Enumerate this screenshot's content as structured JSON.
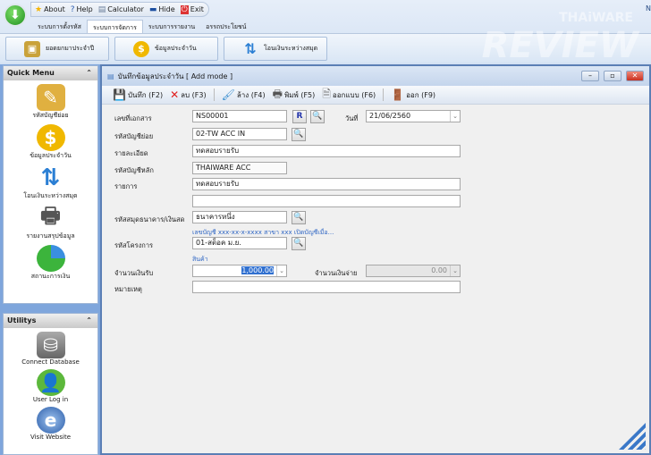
{
  "quick_access": {
    "about": "About",
    "help": "Help",
    "calculator": "Calculator",
    "hide": "Hide",
    "exit": "Exit"
  },
  "tabs": [
    "ระบบการตั้งรหัส",
    "ระบบการจัดการ",
    "ระบบการรายงาน",
    "อรรถประโยชน์"
  ],
  "active_tab": 1,
  "ribbon_buttons": [
    "ยอดยกมาประจำปี",
    "ข้อมูลประจำวัน",
    "โอนเงินระหว่างสมุด"
  ],
  "corner_text": "N",
  "watermark": {
    "top": "THAiWARE",
    "main": "REVIEW"
  },
  "quick_menu": {
    "title": "Quick Menu",
    "items": [
      "รหัสบัญชีย่อย",
      "ข้อมูลประจำวัน",
      "โอนเงินระหว่างสมุด",
      "รายงานสรุปข้อมูล",
      "สถานะการเงิน"
    ]
  },
  "utilitys": {
    "title": "Utilitys",
    "items": [
      "Connect Database",
      "User Log in",
      "Visit Website"
    ]
  },
  "window": {
    "title": "บันทึกข้อมูลประจำวัน [ Add mode ]"
  },
  "toolbar": {
    "save": "บันทึก (F2)",
    "delete": "ลบ (F3)",
    "clear": "ล้าง (F4)",
    "print": "พิมพ์ (F5)",
    "design": "ออกแบบ (F6)",
    "exit": "ออก (F9)"
  },
  "form": {
    "doc_no_label": "เลขที่เอกสาร",
    "doc_no": "NS00001",
    "r_button": "R",
    "date_label": "วันที่",
    "date": "21/06/2560",
    "sub_account_label": "รหัสบัญชีย่อย",
    "sub_account": "02-TW ACC IN",
    "detail_label": "รายละเอียด",
    "detail": "ทดสอบรายรับ",
    "main_account_label": "รหัสบัญชีหลัก",
    "main_account": "THAIWARE ACC",
    "item_label": "รายการ",
    "item": "ทดสอบรายรับ",
    "item2": "",
    "bank_label": "รหัสสมุดธนาคาร/เงินสด",
    "bank": "ธนาคารหนึ่ง",
    "bank_info": "เลขบัญชี xxx-xx-x-xxxx สาขา xxx เปิดบัญชีเมื่อ...",
    "project_label": "รหัสโครงการ",
    "project": "01-สต็อค ม.ย.",
    "project_info": "สินค้า",
    "income_label": "จำนวนเงินรับ",
    "income": "1,000.00",
    "expense_label": "จำนวนเงินจ่าย",
    "expense": "0.00",
    "note_label": "หมายเหตุ",
    "note": ""
  }
}
